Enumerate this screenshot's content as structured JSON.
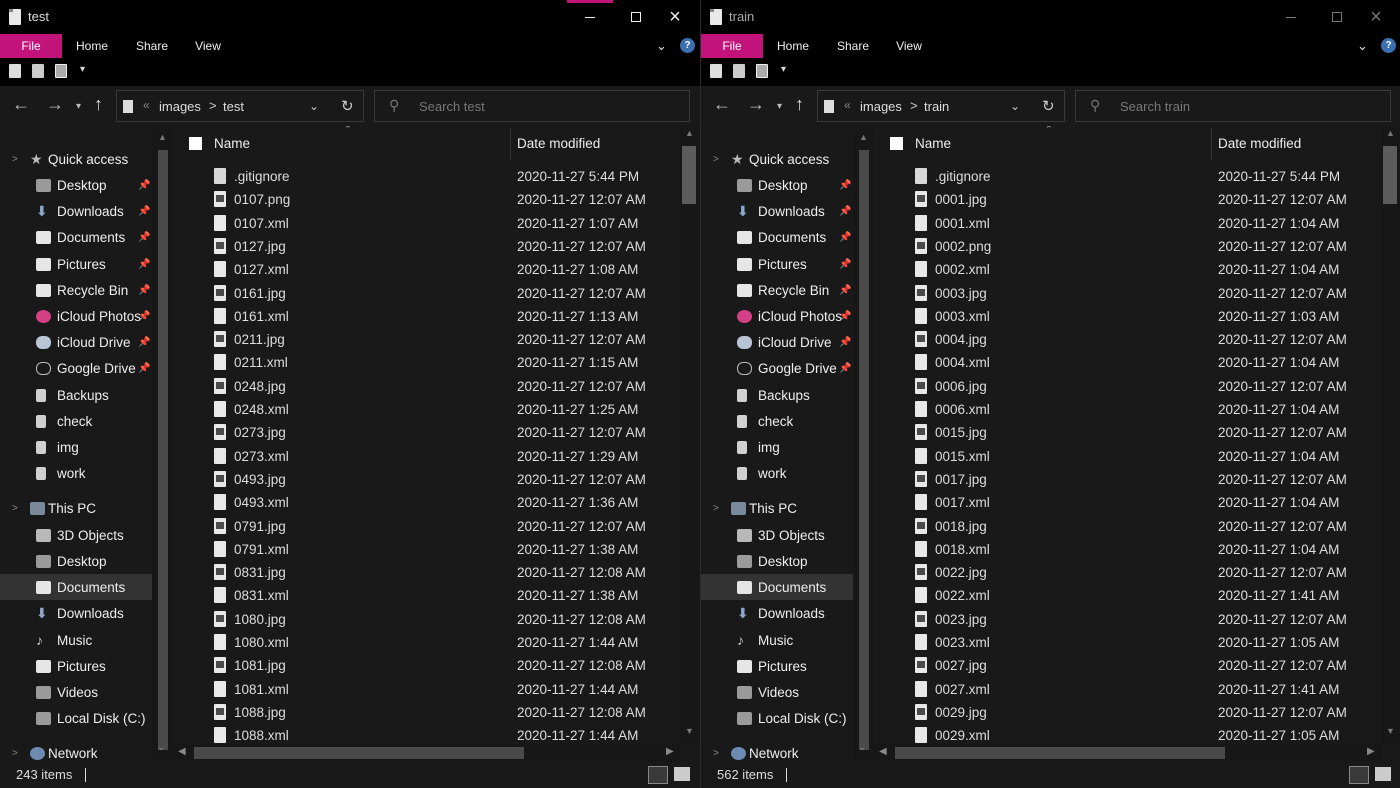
{
  "windows": [
    {
      "title": "test",
      "ribbon_tabs": [
        "File",
        "Home",
        "Share",
        "View"
      ],
      "address": {
        "root_chevron": "«",
        "seg1": "images",
        "sep": ">",
        "seg2": "test"
      },
      "search_placeholder": "Search test",
      "header": {
        "name": "Name",
        "date": "Date modified"
      },
      "nav": [
        {
          "label": "Quick access",
          "icon": "star-icon"
        },
        {
          "label": "Desktop",
          "icon": "desktop-icon",
          "pinned": "📌"
        },
        {
          "label": "Downloads",
          "icon": "download-icon",
          "pinned": "📌"
        },
        {
          "label": "Documents",
          "icon": "documents-icon",
          "pinned": "📌"
        },
        {
          "label": "Pictures",
          "icon": "pictures-icon",
          "pinned": "📌"
        },
        {
          "label": "Recycle Bin",
          "icon": "recycle-bin-icon",
          "pinned": "📌"
        },
        {
          "label": "iCloud Photos",
          "icon": "icloud-photos-icon",
          "pinned": "📌"
        },
        {
          "label": "iCloud Drive",
          "icon": "icloud-drive-icon",
          "pinned": "📌"
        },
        {
          "label": "Google Drive",
          "icon": "google-drive-icon",
          "pinned": "📌"
        },
        {
          "label": "Backups",
          "icon": "folder-icon"
        },
        {
          "label": "check",
          "icon": "folder-icon"
        },
        {
          "label": "img",
          "icon": "folder-icon"
        },
        {
          "label": "work",
          "icon": "folder-icon"
        },
        {
          "label": "This PC",
          "icon": "this-pc-icon"
        },
        {
          "label": "3D Objects",
          "icon": "3d-objects-icon"
        },
        {
          "label": "Desktop",
          "icon": "desktop-icon"
        },
        {
          "label": "Documents",
          "icon": "documents-icon"
        },
        {
          "label": "Downloads",
          "icon": "download-icon"
        },
        {
          "label": "Music",
          "icon": "music-icon"
        },
        {
          "label": "Pictures",
          "icon": "pictures-icon"
        },
        {
          "label": "Videos",
          "icon": "videos-icon"
        },
        {
          "label": "Local Disk (C:)",
          "icon": "local-disk-icon"
        },
        {
          "label": "Network",
          "icon": "network-icon"
        }
      ],
      "files": [
        {
          "name": ".gitignore",
          "date": "2020-11-27 5:44 PM",
          "kind": "txt"
        },
        {
          "name": "0107.png",
          "date": "2020-11-27 12:07 AM",
          "kind": "img"
        },
        {
          "name": "0107.xml",
          "date": "2020-11-27 1:07 AM",
          "kind": "doc"
        },
        {
          "name": "0127.jpg",
          "date": "2020-11-27 12:07 AM",
          "kind": "img"
        },
        {
          "name": "0127.xml",
          "date": "2020-11-27 1:08 AM",
          "kind": "doc"
        },
        {
          "name": "0161.jpg",
          "date": "2020-11-27 12:07 AM",
          "kind": "img"
        },
        {
          "name": "0161.xml",
          "date": "2020-11-27 1:13 AM",
          "kind": "doc"
        },
        {
          "name": "0211.jpg",
          "date": "2020-11-27 12:07 AM",
          "kind": "img"
        },
        {
          "name": "0211.xml",
          "date": "2020-11-27 1:15 AM",
          "kind": "doc"
        },
        {
          "name": "0248.jpg",
          "date": "2020-11-27 12:07 AM",
          "kind": "img"
        },
        {
          "name": "0248.xml",
          "date": "2020-11-27 1:25 AM",
          "kind": "doc"
        },
        {
          "name": "0273.jpg",
          "date": "2020-11-27 12:07 AM",
          "kind": "img"
        },
        {
          "name": "0273.xml",
          "date": "2020-11-27 1:29 AM",
          "kind": "doc"
        },
        {
          "name": "0493.jpg",
          "date": "2020-11-27 12:07 AM",
          "kind": "img"
        },
        {
          "name": "0493.xml",
          "date": "2020-11-27 1:36 AM",
          "kind": "doc"
        },
        {
          "name": "0791.jpg",
          "date": "2020-11-27 12:07 AM",
          "kind": "img"
        },
        {
          "name": "0791.xml",
          "date": "2020-11-27 1:38 AM",
          "kind": "doc"
        },
        {
          "name": "0831.jpg",
          "date": "2020-11-27 12:08 AM",
          "kind": "img"
        },
        {
          "name": "0831.xml",
          "date": "2020-11-27 1:38 AM",
          "kind": "doc"
        },
        {
          "name": "1080.jpg",
          "date": "2020-11-27 12:08 AM",
          "kind": "img"
        },
        {
          "name": "1080.xml",
          "date": "2020-11-27 1:44 AM",
          "kind": "doc"
        },
        {
          "name": "1081.jpg",
          "date": "2020-11-27 12:08 AM",
          "kind": "img"
        },
        {
          "name": "1081.xml",
          "date": "2020-11-27 1:44 AM",
          "kind": "doc"
        },
        {
          "name": "1088.jpg",
          "date": "2020-11-27 12:08 AM",
          "kind": "img"
        },
        {
          "name": "1088.xml",
          "date": "2020-11-27 1:44 AM",
          "kind": "doc"
        }
      ],
      "status": "243 items"
    },
    {
      "title": "train",
      "ribbon_tabs": [
        "File",
        "Home",
        "Share",
        "View"
      ],
      "address": {
        "root_chevron": "«",
        "seg1": "images",
        "sep": ">",
        "seg2": "train"
      },
      "search_placeholder": "Search train",
      "header": {
        "name": "Name",
        "date": "Date modified"
      },
      "nav": [
        {
          "label": "Quick access",
          "icon": "star-icon"
        },
        {
          "label": "Desktop",
          "icon": "desktop-icon",
          "pinned": "📌"
        },
        {
          "label": "Downloads",
          "icon": "download-icon",
          "pinned": "📌"
        },
        {
          "label": "Documents",
          "icon": "documents-icon",
          "pinned": "📌"
        },
        {
          "label": "Pictures",
          "icon": "pictures-icon",
          "pinned": "📌"
        },
        {
          "label": "Recycle Bin",
          "icon": "recycle-bin-icon",
          "pinned": "📌"
        },
        {
          "label": "iCloud Photos",
          "icon": "icloud-photos-icon",
          "pinned": "📌"
        },
        {
          "label": "iCloud Drive",
          "icon": "icloud-drive-icon",
          "pinned": "📌"
        },
        {
          "label": "Google Drive",
          "icon": "google-drive-icon",
          "pinned": "📌"
        },
        {
          "label": "Backups",
          "icon": "folder-icon"
        },
        {
          "label": "check",
          "icon": "folder-icon"
        },
        {
          "label": "img",
          "icon": "folder-icon"
        },
        {
          "label": "work",
          "icon": "folder-icon"
        },
        {
          "label": "This PC",
          "icon": "this-pc-icon"
        },
        {
          "label": "3D Objects",
          "icon": "3d-objects-icon"
        },
        {
          "label": "Desktop",
          "icon": "desktop-icon"
        },
        {
          "label": "Documents",
          "icon": "documents-icon"
        },
        {
          "label": "Downloads",
          "icon": "download-icon"
        },
        {
          "label": "Music",
          "icon": "music-icon"
        },
        {
          "label": "Pictures",
          "icon": "pictures-icon"
        },
        {
          "label": "Videos",
          "icon": "videos-icon"
        },
        {
          "label": "Local Disk (C:)",
          "icon": "local-disk-icon"
        },
        {
          "label": "Network",
          "icon": "network-icon"
        }
      ],
      "files": [
        {
          "name": ".gitignore",
          "date": "2020-11-27 5:44 PM",
          "kind": "txt"
        },
        {
          "name": "0001.jpg",
          "date": "2020-11-27 12:07 AM",
          "kind": "img"
        },
        {
          "name": "0001.xml",
          "date": "2020-11-27 1:04 AM",
          "kind": "doc"
        },
        {
          "name": "0002.png",
          "date": "2020-11-27 12:07 AM",
          "kind": "img"
        },
        {
          "name": "0002.xml",
          "date": "2020-11-27 1:04 AM",
          "kind": "doc"
        },
        {
          "name": "0003.jpg",
          "date": "2020-11-27 12:07 AM",
          "kind": "img"
        },
        {
          "name": "0003.xml",
          "date": "2020-11-27 1:03 AM",
          "kind": "doc"
        },
        {
          "name": "0004.jpg",
          "date": "2020-11-27 12:07 AM",
          "kind": "img"
        },
        {
          "name": "0004.xml",
          "date": "2020-11-27 1:04 AM",
          "kind": "doc"
        },
        {
          "name": "0006.jpg",
          "date": "2020-11-27 12:07 AM",
          "kind": "img"
        },
        {
          "name": "0006.xml",
          "date": "2020-11-27 1:04 AM",
          "kind": "doc"
        },
        {
          "name": "0015.jpg",
          "date": "2020-11-27 12:07 AM",
          "kind": "img"
        },
        {
          "name": "0015.xml",
          "date": "2020-11-27 1:04 AM",
          "kind": "doc"
        },
        {
          "name": "0017.jpg",
          "date": "2020-11-27 12:07 AM",
          "kind": "img"
        },
        {
          "name": "0017.xml",
          "date": "2020-11-27 1:04 AM",
          "kind": "doc"
        },
        {
          "name": "0018.jpg",
          "date": "2020-11-27 12:07 AM",
          "kind": "img"
        },
        {
          "name": "0018.xml",
          "date": "2020-11-27 1:04 AM",
          "kind": "doc"
        },
        {
          "name": "0022.jpg",
          "date": "2020-11-27 12:07 AM",
          "kind": "img"
        },
        {
          "name": "0022.xml",
          "date": "2020-11-27 1:41 AM",
          "kind": "doc"
        },
        {
          "name": "0023.jpg",
          "date": "2020-11-27 12:07 AM",
          "kind": "img"
        },
        {
          "name": "0023.xml",
          "date": "2020-11-27 1:05 AM",
          "kind": "doc"
        },
        {
          "name": "0027.jpg",
          "date": "2020-11-27 12:07 AM",
          "kind": "img"
        },
        {
          "name": "0027.xml",
          "date": "2020-11-27 1:41 AM",
          "kind": "doc"
        },
        {
          "name": "0029.jpg",
          "date": "2020-11-27 12:07 AM",
          "kind": "img"
        },
        {
          "name": "0029.xml",
          "date": "2020-11-27 1:05 AM",
          "kind": "doc"
        }
      ],
      "status": "562 items"
    }
  ],
  "colors": {
    "accent": "#c2137a",
    "bg": "#191919",
    "chrome": "#000000",
    "selected": "#333333"
  },
  "icons": {
    "back": "←",
    "forward": "→",
    "up": "↑",
    "dropdown": "▾",
    "refresh": "↻",
    "search": "⚲",
    "chevron_down": "⌄",
    "help": "?",
    "pane_expand": ">"
  }
}
